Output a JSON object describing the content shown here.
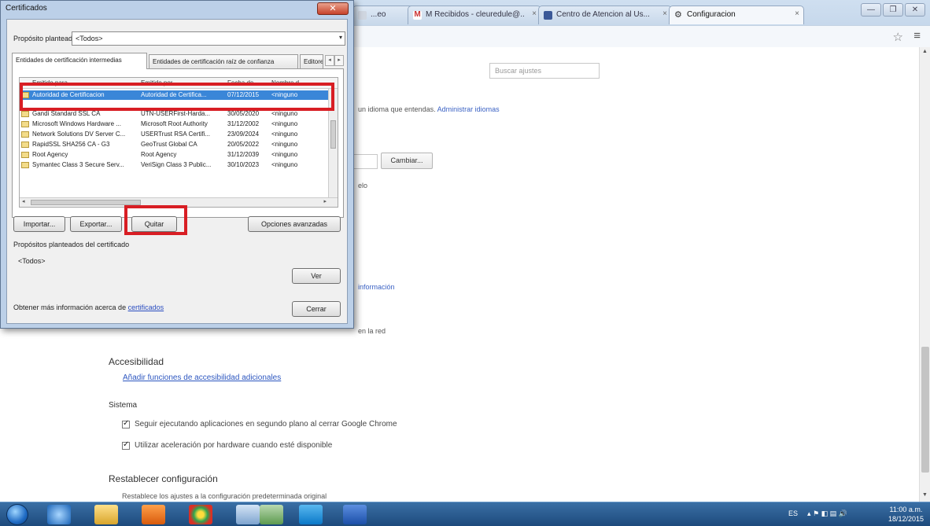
{
  "browser": {
    "tabs": [
      {
        "label": "...eo",
        "icon": "page-icon"
      },
      {
        "label": "M Recibidos - cleuredule@..",
        "icon": "gmail-icon"
      },
      {
        "label": "Centro de Atencion al Us...",
        "icon": "facebook-icon"
      },
      {
        "label": "Configuracion",
        "icon": "gear-icon"
      }
    ]
  },
  "settings": {
    "search_placeholder": "Buscar ajustes",
    "language_text": "un idioma que entendas.",
    "language_link": "Administrar idiomas",
    "cambiar_button": "Cambiar...",
    "partial_text_1": "elo",
    "partial_link": "información",
    "partial_text_2": "en la red",
    "accessibility_title": "Accesibilidad",
    "accessibility_link": "Añadir funciones de accesibilidad adicionales",
    "system_title": "Sistema",
    "system_options": [
      "Seguir ejecutando aplicaciones en segundo plano al cerrar Google Chrome",
      "Utilizar aceleración por hardware cuando esté disponible"
    ],
    "reset_title": "Restablecer configuración",
    "reset_text": "Restablece los ajustes a la configuración predeterminada original"
  },
  "dialog": {
    "title": "Certificados",
    "purpose_label": "Propósito planteado:",
    "purpose_value": "<Todos>",
    "tabs": [
      "Entidades de certificación intermedias",
      "Entidades de certificación raíz de confianza",
      "Editore"
    ],
    "list_headers": [
      "Emitido para",
      "Emitido por",
      "Fecha de...",
      "Nombre d"
    ],
    "certificates": [
      {
        "to": "Autoridad de Certificacion",
        "by": "Autoridad de Certifica...",
        "date": "07/12/2015",
        "name": "<ninguno"
      },
      {
        "to": "Gandi Standard SSL CA",
        "by": "UTN-USERFirst-Harda...",
        "date": "30/05/2020",
        "name": "<ninguno"
      },
      {
        "to": "Microsoft Windows Hardware ...",
        "by": "Microsoft Root Authority",
        "date": "31/12/2002",
        "name": "<ninguno"
      },
      {
        "to": "Network Solutions DV Server C...",
        "by": "USERTrust RSA Certifi...",
        "date": "23/09/2024",
        "name": "<ninguno"
      },
      {
        "to": "RapidSSL SHA256 CA - G3",
        "by": "GeoTrust Global CA",
        "date": "20/05/2022",
        "name": "<ninguno"
      },
      {
        "to": "Root Agency",
        "by": "Root Agency",
        "date": "31/12/2039",
        "name": "<ninguno"
      },
      {
        "to": "Symantec Class 3 Secure Serv...",
        "by": "VeriSign Class 3 Public...",
        "date": "30/10/2023",
        "name": "<ninguno"
      }
    ],
    "buttons": {
      "import": "Importar...",
      "export": "Exportar...",
      "remove": "Quitar",
      "advanced": "Opciones avanzadas",
      "view": "Ver",
      "close": "Cerrar"
    },
    "purposes_label": "Propósitos planteados del certificado",
    "purposes_value": "<Todos>",
    "more_info_text": "Obtener más información acerca de",
    "more_info_link": "certificados"
  },
  "taskbar": {
    "language": "ES",
    "time": "11:00 a.m.",
    "date": "18/12/2015"
  },
  "colors": {
    "highlight": "#d81e24",
    "selection": "#3a86d8",
    "link": "#2d57c0"
  }
}
